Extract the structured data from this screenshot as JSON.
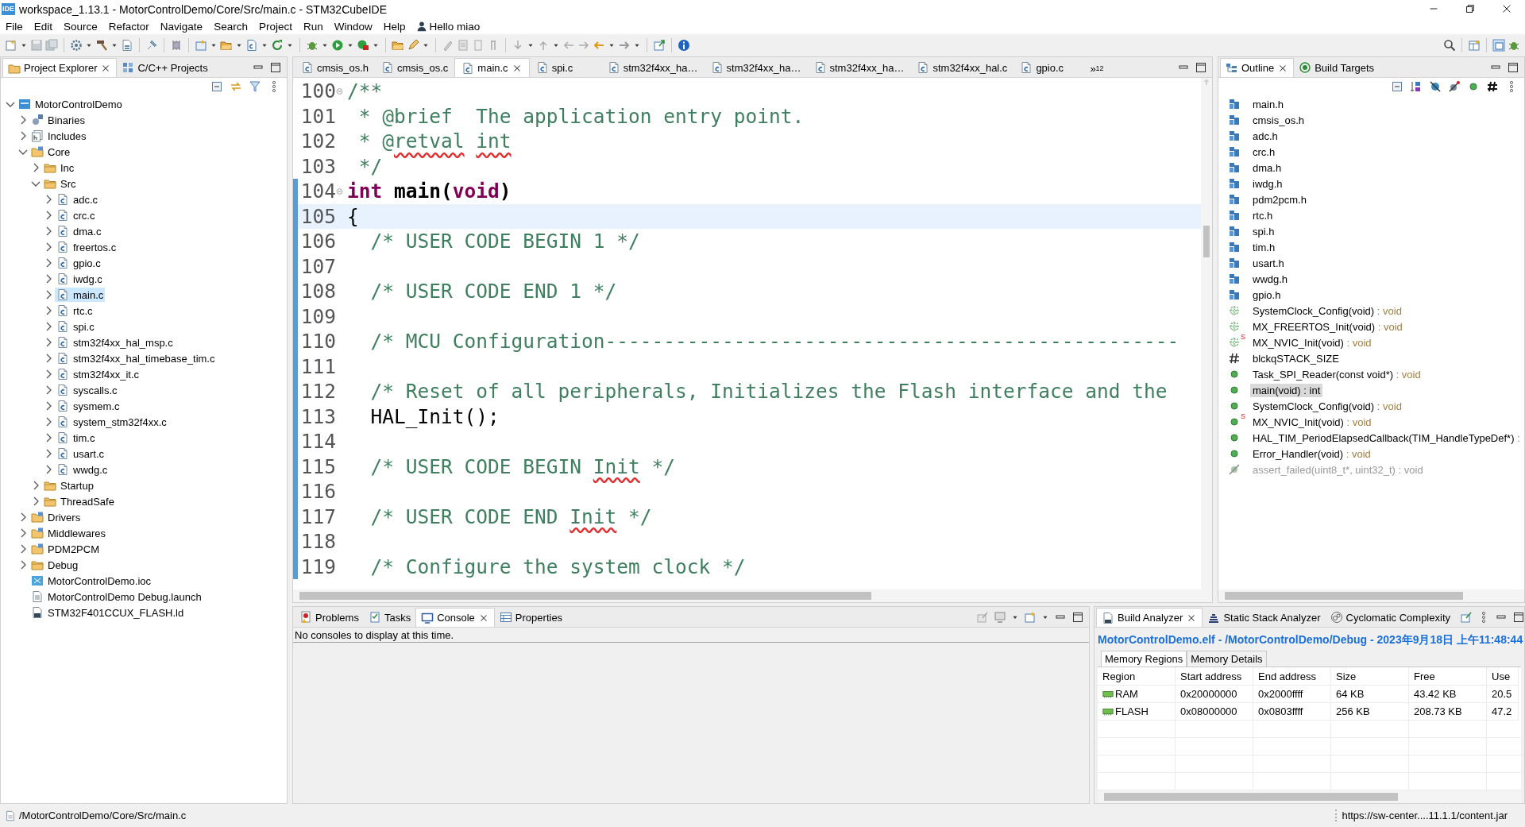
{
  "window": {
    "logo": "IDE",
    "title": "workspace_1.13.1 - MotorControlDemo/Core/Src/main.c - STM32CubeIDE"
  },
  "menu": [
    "File",
    "Edit",
    "Source",
    "Refactor",
    "Navigate",
    "Search",
    "Project",
    "Run",
    "Window",
    "Help"
  ],
  "user": {
    "name": "Hello miao"
  },
  "project_explorer": {
    "tabs": [
      {
        "label": "Project Explorer",
        "kind": "explorer",
        "selected": true
      },
      {
        "label": "C/C++ Projects",
        "kind": "projects",
        "selected": false
      }
    ],
    "tree": [
      {
        "label": "MotorControlDemo",
        "kind": "project",
        "expanded": true,
        "selected": false,
        "children": [
          {
            "label": "Binaries",
            "kind": "binaries",
            "expanded": false,
            "selected": false
          },
          {
            "label": "Includes",
            "kind": "includes",
            "expanded": false,
            "selected": false
          },
          {
            "label": "Core",
            "kind": "srcfolder",
            "expanded": true,
            "selected": false,
            "children": [
              {
                "label": "Inc",
                "kind": "folder",
                "expanded": false,
                "selected": false
              },
              {
                "label": "Src",
                "kind": "folder",
                "expanded": true,
                "selected": false,
                "children": [
                  {
                    "label": "adc.c",
                    "kind": "cfile",
                    "expanded": false,
                    "selected": false
                  },
                  {
                    "label": "crc.c",
                    "kind": "cfile",
                    "expanded": false,
                    "selected": false
                  },
                  {
                    "label": "dma.c",
                    "kind": "cfile",
                    "expanded": false,
                    "selected": false
                  },
                  {
                    "label": "freertos.c",
                    "kind": "cfile",
                    "expanded": false,
                    "selected": false
                  },
                  {
                    "label": "gpio.c",
                    "kind": "cfile",
                    "expanded": false,
                    "selected": false
                  },
                  {
                    "label": "iwdg.c",
                    "kind": "cfile",
                    "expanded": false,
                    "selected": false
                  },
                  {
                    "label": "main.c",
                    "kind": "cfile",
                    "expanded": false,
                    "selected": true
                  },
                  {
                    "label": "rtc.c",
                    "kind": "cfile",
                    "expanded": false,
                    "selected": false
                  },
                  {
                    "label": "spi.c",
                    "kind": "cfile",
                    "expanded": false,
                    "selected": false
                  },
                  {
                    "label": "stm32f4xx_hal_msp.c",
                    "kind": "cfile",
                    "expanded": false,
                    "selected": false
                  },
                  {
                    "label": "stm32f4xx_hal_timebase_tim.c",
                    "kind": "cfile",
                    "expanded": false,
                    "selected": false
                  },
                  {
                    "label": "stm32f4xx_it.c",
                    "kind": "cfile",
                    "expanded": false,
                    "selected": false
                  },
                  {
                    "label": "syscalls.c",
                    "kind": "cfile",
                    "expanded": false,
                    "selected": false
                  },
                  {
                    "label": "sysmem.c",
                    "kind": "cfile",
                    "expanded": false,
                    "selected": false
                  },
                  {
                    "label": "system_stm32f4xx.c",
                    "kind": "cfile",
                    "expanded": false,
                    "selected": false
                  },
                  {
                    "label": "tim.c",
                    "kind": "cfile",
                    "expanded": false,
                    "selected": false
                  },
                  {
                    "label": "usart.c",
                    "kind": "cfile",
                    "expanded": false,
                    "selected": false
                  },
                  {
                    "label": "wwdg.c",
                    "kind": "cfile",
                    "expanded": false,
                    "selected": false
                  }
                ]
              },
              {
                "label": "Startup",
                "kind": "folder",
                "expanded": false,
                "selected": false
              },
              {
                "label": "ThreadSafe",
                "kind": "folder",
                "expanded": false,
                "selected": false
              }
            ]
          },
          {
            "label": "Drivers",
            "kind": "srcfolder",
            "expanded": false,
            "selected": false
          },
          {
            "label": "Middlewares",
            "kind": "srcfolder",
            "expanded": false,
            "selected": false
          },
          {
            "label": "PDM2PCM",
            "kind": "srcfolder",
            "expanded": false,
            "selected": false
          },
          {
            "label": "Debug",
            "kind": "folder",
            "expanded": false,
            "selected": false
          },
          {
            "label": "MotorControlDemo.ioc",
            "kind": "mx",
            "selected": false
          },
          {
            "label": "MotorControlDemo Debug.launch",
            "kind": "launch",
            "selected": false
          },
          {
            "label": "STM32F401CCUX_FLASH.ld",
            "kind": "ld",
            "selected": false
          }
        ]
      }
    ]
  },
  "editor": {
    "tabs": [
      {
        "label": "cmsis_os.h",
        "selected": false
      },
      {
        "label": "cmsis_os.c",
        "selected": false
      },
      {
        "label": "main.c",
        "selected": true
      },
      {
        "label": "spi.c",
        "selected": false
      },
      {
        "label": "stm32f4xx_ha…",
        "selected": false
      },
      {
        "label": "stm32f4xx_ha…",
        "selected": false
      },
      {
        "label": "stm32f4xx_ha…",
        "selected": false
      },
      {
        "label": "stm32f4xx_hal.c",
        "selected": false
      },
      {
        "label": "gpio.c",
        "selected": false
      }
    ],
    "more_tabs": {
      "glyph": "»",
      "count": "12"
    },
    "lines": [
      {
        "number": "100",
        "foldable": true,
        "in_scope": false,
        "current": false,
        "segments": [
          {
            "text": "/**",
            "kind": "comment"
          }
        ]
      },
      {
        "number": "101",
        "foldable": false,
        "in_scope": false,
        "current": false,
        "segments": [
          {
            "text": " * @brief  The application entry point.",
            "kind": "comment"
          }
        ]
      },
      {
        "number": "102",
        "foldable": false,
        "in_scope": false,
        "current": false,
        "segments": [
          {
            "text": " * @",
            "kind": "comment"
          },
          {
            "text": "retval",
            "kind": "misspelled"
          },
          {
            "text": " int",
            "kind": "misspelled"
          }
        ]
      },
      {
        "number": "103",
        "foldable": false,
        "in_scope": false,
        "current": false,
        "segments": [
          {
            "text": " */",
            "kind": "comment"
          }
        ]
      },
      {
        "number": "104",
        "foldable": true,
        "in_scope": true,
        "current": false,
        "segments": [
          {
            "text": "int",
            "kind": "keyword"
          },
          {
            "text": " main(",
            "kind": "declaration"
          },
          {
            "text": "void",
            "kind": "keyword"
          },
          {
            "text": ")",
            "kind": "declaration"
          }
        ]
      },
      {
        "number": "105",
        "foldable": false,
        "in_scope": true,
        "current": true,
        "segments": [
          {
            "text": "{",
            "kind": "code"
          }
        ]
      },
      {
        "number": "106",
        "foldable": false,
        "in_scope": true,
        "current": false,
        "segments": [
          {
            "text": "  /* USER CODE BEGIN 1 */",
            "kind": "comment"
          }
        ]
      },
      {
        "number": "107",
        "foldable": false,
        "in_scope": true,
        "current": false
      },
      {
        "number": "108",
        "foldable": false,
        "in_scope": true,
        "current": false,
        "segments": [
          {
            "text": "  /* USER CODE END 1 */",
            "kind": "comment"
          }
        ]
      },
      {
        "number": "109",
        "foldable": false,
        "in_scope": true,
        "current": false
      },
      {
        "number": "110",
        "foldable": false,
        "in_scope": true,
        "current": false,
        "segments": [
          {
            "text": "  /* MCU Configuration-------------------------------------------------",
            "kind": "comment"
          }
        ]
      },
      {
        "number": "111",
        "foldable": false,
        "in_scope": true,
        "current": false
      },
      {
        "number": "112",
        "foldable": false,
        "in_scope": true,
        "current": false,
        "segments": [
          {
            "text": "  /* Reset of all peripherals, Initializes the Flash interface and the",
            "kind": "comment"
          }
        ]
      },
      {
        "number": "113",
        "foldable": false,
        "in_scope": true,
        "current": false,
        "segments": [
          {
            "text": "  HAL_Init();",
            "kind": "code"
          }
        ]
      },
      {
        "number": "114",
        "foldable": false,
        "in_scope": true,
        "current": false
      },
      {
        "number": "115",
        "foldable": false,
        "in_scope": true,
        "current": false,
        "segments": [
          {
            "text": "  /* USER CODE BEGIN ",
            "kind": "comment"
          },
          {
            "text": "Init",
            "kind": "misspelled"
          },
          {
            "text": " */",
            "kind": "comment"
          }
        ]
      },
      {
        "number": "116",
        "foldable": false,
        "in_scope": true,
        "current": false
      },
      {
        "number": "117",
        "foldable": false,
        "in_scope": true,
        "current": false,
        "segments": [
          {
            "text": "  /* USER CODE END ",
            "kind": "comment"
          },
          {
            "text": "Init",
            "kind": "misspelled"
          },
          {
            "text": " */",
            "kind": "comment"
          }
        ]
      },
      {
        "number": "118",
        "foldable": false,
        "in_scope": true,
        "current": false
      },
      {
        "number": "119",
        "foldable": false,
        "in_scope": true,
        "current": false,
        "segments": [
          {
            "text": "  /* Configure the system clock */",
            "kind": "comment"
          }
        ]
      }
    ]
  },
  "outline": {
    "tabs": [
      {
        "label": "Outline",
        "kind": "outline",
        "selected": true
      },
      {
        "label": "Build Targets",
        "kind": "targets",
        "selected": false
      }
    ],
    "items": [
      {
        "kind": "include",
        "name": "main.h",
        "selected": false
      },
      {
        "kind": "include",
        "name": "cmsis_os.h",
        "selected": false
      },
      {
        "kind": "include",
        "name": "adc.h",
        "selected": false
      },
      {
        "kind": "include",
        "name": "crc.h",
        "selected": false
      },
      {
        "kind": "include",
        "name": "dma.h",
        "selected": false
      },
      {
        "kind": "include",
        "name": "iwdg.h",
        "selected": false
      },
      {
        "kind": "include",
        "name": "pdm2pcm.h",
        "selected": false
      },
      {
        "kind": "include",
        "name": "rtc.h",
        "selected": false
      },
      {
        "kind": "include",
        "name": "spi.h",
        "selected": false
      },
      {
        "kind": "include",
        "name": "tim.h",
        "selected": false
      },
      {
        "kind": "include",
        "name": "usart.h",
        "selected": false
      },
      {
        "kind": "include",
        "name": "wwdg.h",
        "selected": false
      },
      {
        "kind": "include",
        "name": "gpio.h",
        "selected": false
      },
      {
        "kind": "declaration",
        "name": "SystemClock_Config(void)",
        "type": " : void",
        "selected": false
      },
      {
        "kind": "declaration",
        "name": "MX_FREERTOS_Init(void)",
        "type": " : void",
        "selected": false
      },
      {
        "kind": "declaration",
        "badge": "S",
        "name": "MX_NVIC_Init(void)",
        "type": " : void",
        "selected": false
      },
      {
        "kind": "macro",
        "name": "blckqSTACK_SIZE",
        "selected": false
      },
      {
        "kind": "function",
        "name": "Task_SPI_Reader(const void*)",
        "type": " : void",
        "selected": false
      },
      {
        "kind": "function",
        "name": "main(void) : int",
        "selected": true
      },
      {
        "kind": "function",
        "name": "SystemClock_Config(void)",
        "type": " : void",
        "selected": false
      },
      {
        "kind": "function",
        "badge": "S",
        "name": "MX_NVIC_Init(void)",
        "type": " : void",
        "selected": false
      },
      {
        "kind": "function",
        "name": "HAL_TIM_PeriodElapsedCallback(TIM_HandleTypeDef*)",
        "type": " :",
        "selected": false
      },
      {
        "kind": "function",
        "name": "Error_Handler(void)",
        "type": " : void",
        "selected": false
      },
      {
        "kind": "inactive",
        "name": "assert_failed(uint8_t*, uint32_t) : void",
        "selected": false
      }
    ]
  },
  "console": {
    "tabs": [
      {
        "label": "Problems",
        "kind": "problems",
        "selected": false
      },
      {
        "label": "Tasks",
        "kind": "tasks",
        "selected": false
      },
      {
        "label": "Console",
        "kind": "console",
        "selected": true
      },
      {
        "label": "Properties",
        "kind": "properties",
        "selected": false
      }
    ],
    "message": "No consoles to display at this time."
  },
  "build_analyzer": {
    "tabs": [
      {
        "label": "Build Analyzer",
        "kind": "analyzer",
        "selected": true
      },
      {
        "label": "Static Stack Analyzer",
        "kind": "stack",
        "selected": false
      },
      {
        "label": "Cyclomatic Complexity",
        "kind": "cyclomatic",
        "selected": false
      }
    ],
    "heading": "MotorControlDemo.elf - /MotorControlDemo/Debug - 2023年9月18日 上午11:48:44",
    "subtabs": [
      {
        "label": "Memory Regions",
        "selected": true
      },
      {
        "label": "Memory Details",
        "selected": false
      }
    ],
    "table": {
      "columns": [
        "Region",
        "Start address",
        "End address",
        "Size",
        "Free",
        "Use"
      ],
      "rows": [
        [
          "RAM",
          "0x20000000",
          "0x2000ffff",
          "64 KB",
          "43.42 KB",
          "20.5"
        ],
        [
          "FLASH",
          "0x08000000",
          "0x0803ffff",
          "256 KB",
          "208.73 KB",
          "47.2"
        ]
      ]
    }
  },
  "status_bar": {
    "path": "/MotorControlDemo/Core/Src/main.c",
    "job": "https://sw-center....11.1.1/content.jar"
  }
}
